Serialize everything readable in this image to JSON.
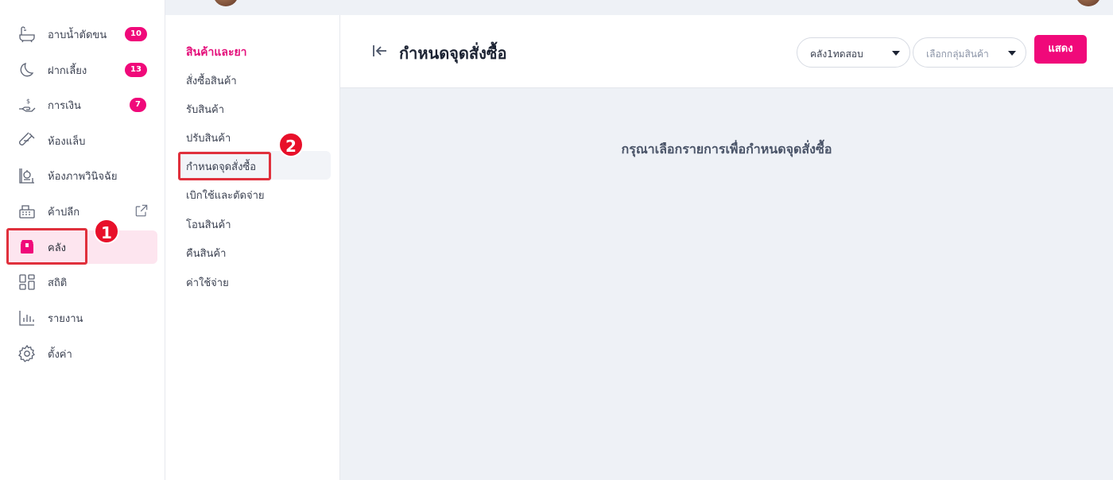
{
  "sidebar": {
    "items": [
      {
        "label": "อาบน้ำตัดขน",
        "icon": "bathtub-icon",
        "badge": "10"
      },
      {
        "label": "ฝากเลี้ยง",
        "icon": "moon-icon",
        "badge": "13"
      },
      {
        "label": "การเงิน",
        "icon": "hand-money-icon",
        "badge": "7"
      },
      {
        "label": "ห้องแล็บ",
        "icon": "test-tube-icon",
        "badge": ""
      },
      {
        "label": "ห้องภาพวินิจฉัย",
        "icon": "xray-machine-icon",
        "badge": ""
      },
      {
        "label": "ค้าปลีก",
        "icon": "cash-register-icon",
        "badge": "",
        "external": true
      },
      {
        "label": "คลัง",
        "icon": "box-icon",
        "badge": "",
        "active": true
      },
      {
        "label": "สถิติ",
        "icon": "dashboard-grid-icon",
        "badge": ""
      },
      {
        "label": "รายงาน",
        "icon": "bar-chart-icon",
        "badge": ""
      },
      {
        "label": "ตั้งค่า",
        "icon": "gear-icon",
        "badge": ""
      }
    ]
  },
  "submenu": {
    "title": "สินค้าและยา",
    "items": [
      {
        "label": "สั่งซื้อสินค้า"
      },
      {
        "label": "รับสินค้า"
      },
      {
        "label": "ปรับสินค้า"
      },
      {
        "label": "กำหนดจุดสั่งซื้อ",
        "active": true
      },
      {
        "label": "เบิกใช้และตัดจ่าย"
      },
      {
        "label": "โอนสินค้า"
      },
      {
        "label": "คืนสินค้า"
      },
      {
        "label": "ค่าใช้จ่าย"
      }
    ]
  },
  "header": {
    "title": "กำหนดจุดสั่งซื้อ",
    "warehouse_select": {
      "value": "คลัง1ทดสอบ"
    },
    "group_select": {
      "placeholder": "เลือกกลุ่มสินค้า"
    },
    "show_button": "แสดง"
  },
  "main": {
    "empty_message": "กรุณาเลือกรายการเพื่อกำหนดจุดสั่งซื้อ"
  },
  "annotations": {
    "step1": "1",
    "step2": "2"
  },
  "colors": {
    "accent": "#f0097a",
    "annotation": "#e0303c"
  }
}
